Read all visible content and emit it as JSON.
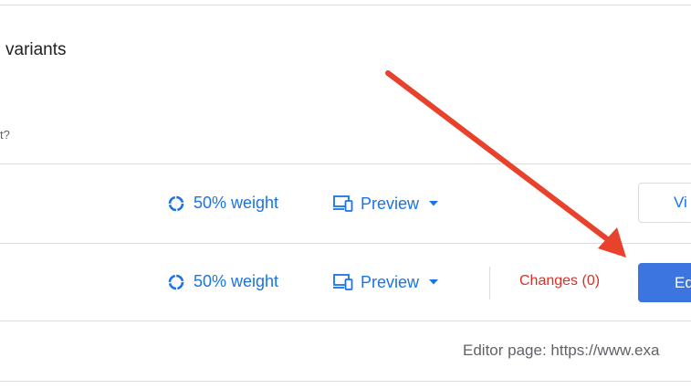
{
  "panel": {
    "title": "variants",
    "question": "t?"
  },
  "variants": [
    {
      "weight_label": "50% weight",
      "preview_label": "Preview",
      "action_label": "Vi"
    },
    {
      "weight_label": "50% weight",
      "preview_label": "Preview",
      "changes_label": "Changes (0)",
      "action_label": "Ed"
    }
  ],
  "editor": {
    "url_text": "Editor page: https://www.exa"
  },
  "icons": {
    "weight": "donut-chart-icon",
    "preview": "devices-icon",
    "dropdown": "caret-down-icon",
    "annotation": "red-arrow-annotation"
  },
  "colors": {
    "link_blue": "#1a73e8",
    "primary_button": "#3c74e0",
    "changes_red": "#d93025",
    "arrow_red": "#e8412c",
    "divider": "#dadce0"
  }
}
